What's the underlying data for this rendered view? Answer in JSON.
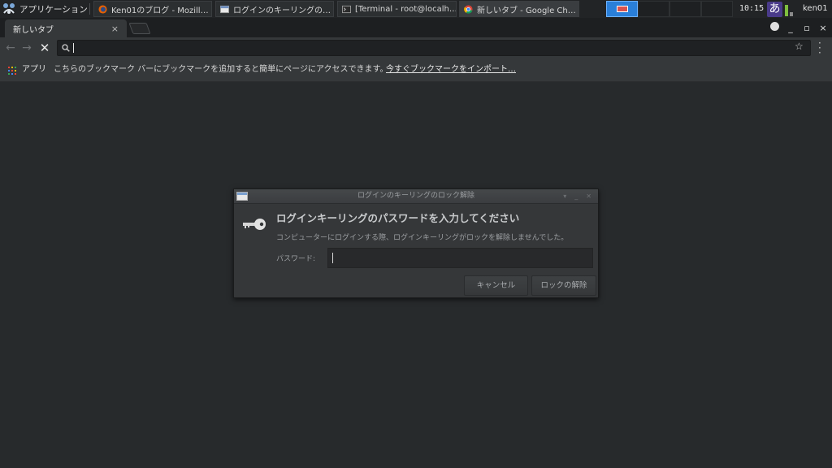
{
  "taskbar": {
    "apps_menu_label": "アプリケーション",
    "tasks": [
      {
        "label": "Ken01のブログ  -  Mozill…",
        "icon": "firefox-icon"
      },
      {
        "label": "ログインのキーリングの…",
        "icon": "window-icon"
      },
      {
        "label": "[Terminal - root@localh…",
        "icon": "terminal-icon"
      },
      {
        "label": "新しいタブ  -  Google Ch…",
        "icon": "chrome-icon"
      }
    ],
    "clock": "10:15",
    "ime_indicator": "あ",
    "user": "ken01"
  },
  "browser": {
    "tab_title": "新しいタブ",
    "tab_close": "×",
    "window_controls": {
      "minimize": "_",
      "maximize": "▫",
      "close": "×"
    },
    "omnibox_value": "",
    "bookmarks_bar": {
      "apps_label": "アプリ",
      "message": "こちらのブックマーク バーにブックマークを追加すると簡単にページにアクセスできます。",
      "import_link": "今すぐブックマークをインポート…"
    }
  },
  "dialog": {
    "title": "ログインのキーリングのロック解除",
    "heading": "ログインキーリングのパスワードを入力してください",
    "description": "コンピューターにログインする際、ログインキーリングがロックを解除しませんでした。",
    "password_label": "パスワード:",
    "password_value": "",
    "cancel_button": "キャンセル",
    "unlock_button": "ロックの解除"
  },
  "colors": {
    "desktop_bg": "#272a2c",
    "chrome_toolbar": "#35383a",
    "workspace_active": "#2a7fd9"
  }
}
